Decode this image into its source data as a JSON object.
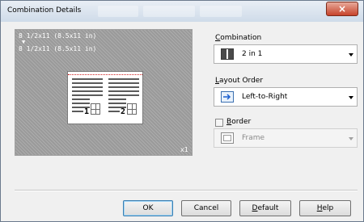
{
  "window": {
    "title": "Combination Details",
    "close_label": "×"
  },
  "preview": {
    "paper_size_1": "8 1/2x11 (8.5x11 in)",
    "arrow": "▼",
    "paper_size_2": "8 1/2x11 (8.5x11 in)",
    "page_1": "1",
    "page_2": "2",
    "copies": "x1"
  },
  "combination": {
    "label_accel": "C",
    "label_rest": "ombination",
    "value": "2 in 1",
    "icon": "two-up-pages-icon"
  },
  "layout_order": {
    "label_accel": "L",
    "label_rest": "ayout Order",
    "value": "Left-to-Right",
    "icon": "arrow-right-icon"
  },
  "border": {
    "label_accel": "B",
    "label_rest": "order",
    "checked": false,
    "value": "Frame",
    "icon": "frame-icon"
  },
  "buttons": {
    "ok": "OK",
    "cancel": "Cancel",
    "default_accel": "D",
    "default_rest": "efault",
    "help_accel": "H",
    "help_rest": "elp"
  },
  "colors": {
    "accent_blue": "#1a5fd0",
    "preview_gray": "#9a9a9a"
  }
}
